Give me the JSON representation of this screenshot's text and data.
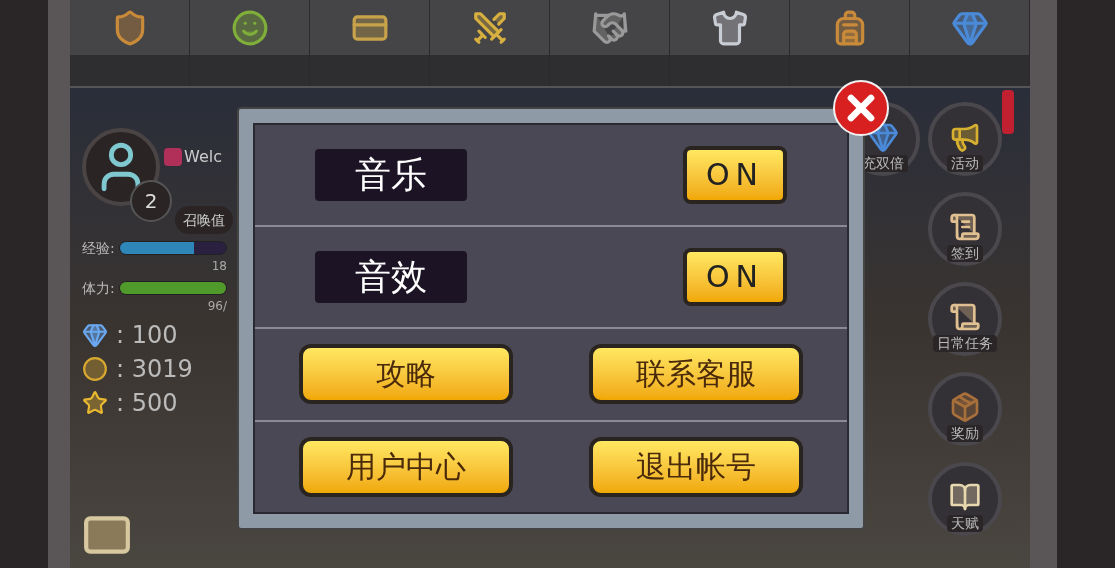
{
  "player": {
    "level": "2",
    "name": "Welc",
    "summon_label": "召唤值",
    "bars": [
      {
        "label": "经验:",
        "reading": "18",
        "level": 0.7,
        "kind": "exp"
      },
      {
        "label": "体力:",
        "reading": "96/",
        "level": 1.0,
        "kind": "stamina"
      }
    ],
    "currencies": [
      {
        "kind": "gem",
        "value": ": 100"
      },
      {
        "kind": "coin",
        "value": ": 3019"
      },
      {
        "kind": "star",
        "value": ": 500"
      }
    ]
  },
  "side_menu": [
    {
      "label": "充双倍",
      "kind": "gem",
      "alert": false
    },
    {
      "label": "活动",
      "kind": "megaphone",
      "alert": true
    },
    {
      "label": "签到",
      "kind": "scroll",
      "alert": false
    },
    {
      "label": "日常任务",
      "kind": "quest",
      "alert": false
    },
    {
      "label": "奖励",
      "kind": "chest",
      "alert": false
    },
    {
      "label": "天赋",
      "kind": "book",
      "alert": false
    }
  ],
  "settings_dialog": {
    "toggles": [
      {
        "label": "音乐",
        "value": "ON",
        "on": true
      },
      {
        "label": "音效",
        "value": "ON",
        "on": true
      }
    ],
    "buttons": [
      [
        "攻略",
        "联系客服"
      ],
      [
        "用户中心",
        "退出帐号"
      ]
    ]
  }
}
